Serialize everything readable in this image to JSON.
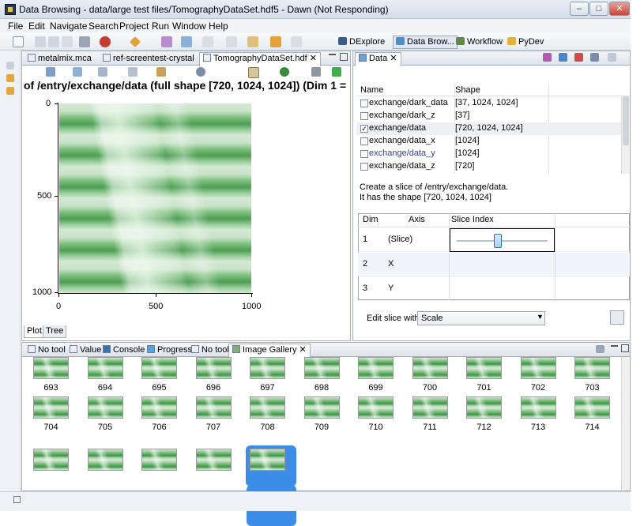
{
  "window": {
    "title": "Data Browsing - data/large test files/TomographyDataSet.hdf5 - Dawn (Not Responding)",
    "minimize": "–",
    "maximize": "□",
    "close": "✕"
  },
  "menu": [
    "File",
    "Edit",
    "Navigate",
    "Search",
    "Project",
    "Run",
    "Window",
    "Help"
  ],
  "perspectives": [
    {
      "label": "DExplore",
      "active": false
    },
    {
      "label": "Data Brow...",
      "active": true
    },
    {
      "label": "Workflow",
      "active": false
    },
    {
      "label": "PyDev",
      "active": false
    }
  ],
  "editor": {
    "tabs": [
      {
        "label": "metalmix.mca"
      },
      {
        "label": "ref-screentest-crystal"
      },
      {
        "label": "TomographyDataSet.hdf"
      }
    ],
    "close_glyph": "✕",
    "heading": "of /entry/exchange/data (full shape [720, 1024, 1024]) (Dim 1 =",
    "y_ticks": [
      "0",
      "500",
      "1000"
    ],
    "x_ticks": [
      "0",
      "500",
      "1000"
    ],
    "bottom_tabs": [
      "Plot",
      "Tree"
    ]
  },
  "data_view": {
    "tab": "Data",
    "columns": {
      "name": "Name",
      "shape": "Shape"
    },
    "rows": [
      {
        "name": "exchange/dark_data",
        "shape": "[37, 1024, 1024]",
        "checked": false,
        "link": false
      },
      {
        "name": "exchange/dark_z",
        "shape": "[37]",
        "checked": false,
        "link": false
      },
      {
        "name": "exchange/data",
        "shape": "[720, 1024, 1024]",
        "checked": true,
        "link": false
      },
      {
        "name": "exchange/data_x",
        "shape": "[1024]",
        "checked": false,
        "link": false
      },
      {
        "name": "exchange/data_y",
        "shape": "[1024]",
        "checked": false,
        "link": true
      },
      {
        "name": "exchange/data_z",
        "shape": "[720]",
        "checked": false,
        "link": false
      }
    ],
    "description_line1": "Create a slice of /entry/exchange/data.",
    "description_line2": "It has the shape [720, 1024, 1024]",
    "slice_columns": {
      "dim": "Dim",
      "axis": "Axis",
      "index": "Slice Index"
    },
    "slice_rows": [
      {
        "dim": "1",
        "axis": "(Slice)"
      },
      {
        "dim": "2",
        "axis": "X"
      },
      {
        "dim": "3",
        "axis": "Y"
      }
    ],
    "slice_position": 0.45,
    "edit_label": "Edit slice with",
    "edit_value": "Scale"
  },
  "bottom_panel": {
    "tabs": [
      "No tool",
      "Value",
      "Console",
      "Progress",
      "No tool",
      "Image Gallery"
    ],
    "row1": [
      "693",
      "694",
      "695",
      "696",
      "697",
      "698",
      "699",
      "700",
      "701",
      "702",
      "703"
    ],
    "row2": [
      "704",
      "705",
      "706",
      "707",
      "708",
      "709",
      "710",
      "711",
      "712",
      "713",
      "714"
    ],
    "row3_count": 5,
    "selected": "708"
  }
}
